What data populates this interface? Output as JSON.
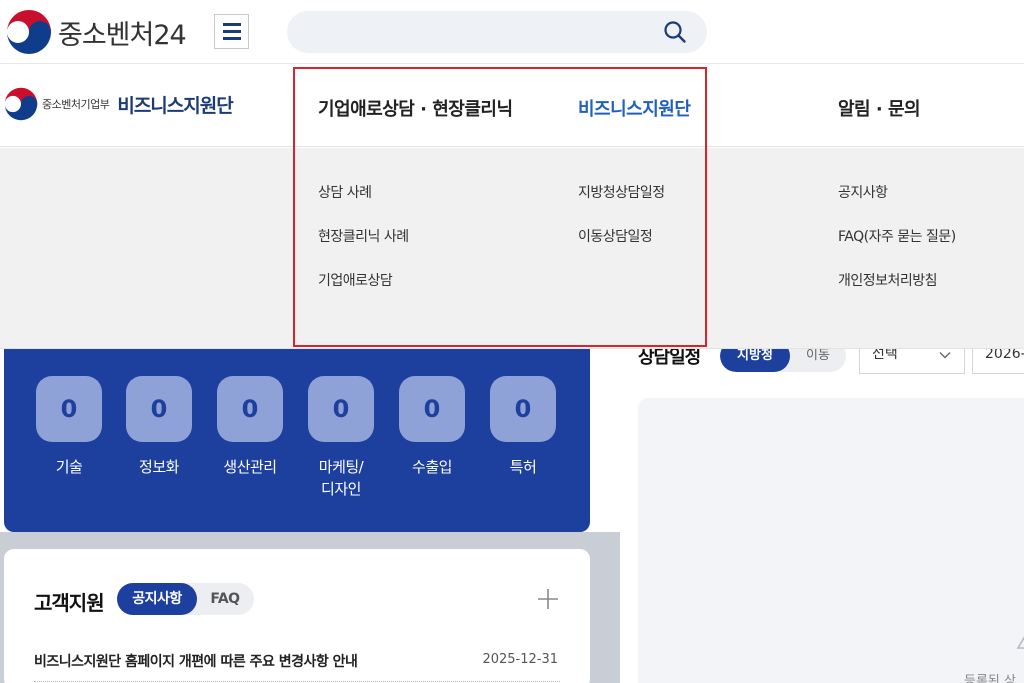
{
  "header": {
    "site_name": "중소벤처24",
    "search_placeholder": ""
  },
  "nav": {
    "ministry": "중소벤처기업부",
    "unit_name": "비즈니스지원단",
    "items": [
      {
        "label": "기업애로상담 · 현장클리닉",
        "active": false
      },
      {
        "label": "비즈니스지원단",
        "active": true
      },
      {
        "label": "알림 · 문의",
        "active": false
      }
    ]
  },
  "dropdown": {
    "col1": [
      "상담 사례",
      "현장클리닉 사례",
      "기업애로상담"
    ],
    "col2": [
      "지방청상담일정",
      "이동상담일정"
    ],
    "col3": [
      "공지사항",
      "FAQ(자주 묻는 질문)",
      "개인정보처리방침"
    ]
  },
  "categories": [
    {
      "count": "0",
      "label": "기술"
    },
    {
      "count": "0",
      "label": "정보화"
    },
    {
      "count": "0",
      "label": "생산관리"
    },
    {
      "count": "0",
      "label": "마케팅/\n디자인"
    },
    {
      "count": "0",
      "label": "수출입"
    },
    {
      "count": "0",
      "label": "특허"
    }
  ],
  "support": {
    "title": "고객지원",
    "tab_notice": "공지사항",
    "tab_faq": "FAQ",
    "post_title": "비즈니스지원단 홈페이지 개편에 따른 주요 변경사항 안내",
    "post_date": "2025-12-31"
  },
  "schedule": {
    "title": "상담일정",
    "tab_local": "지방청",
    "tab_mobile": "이동",
    "select_value": "선택",
    "date_value": "2026-0",
    "empty_text": "등록된 상"
  },
  "colors": {
    "brand_blue": "#1d3f9e",
    "active_nav": "#1f5fbf",
    "highlight": "#d8242b"
  }
}
